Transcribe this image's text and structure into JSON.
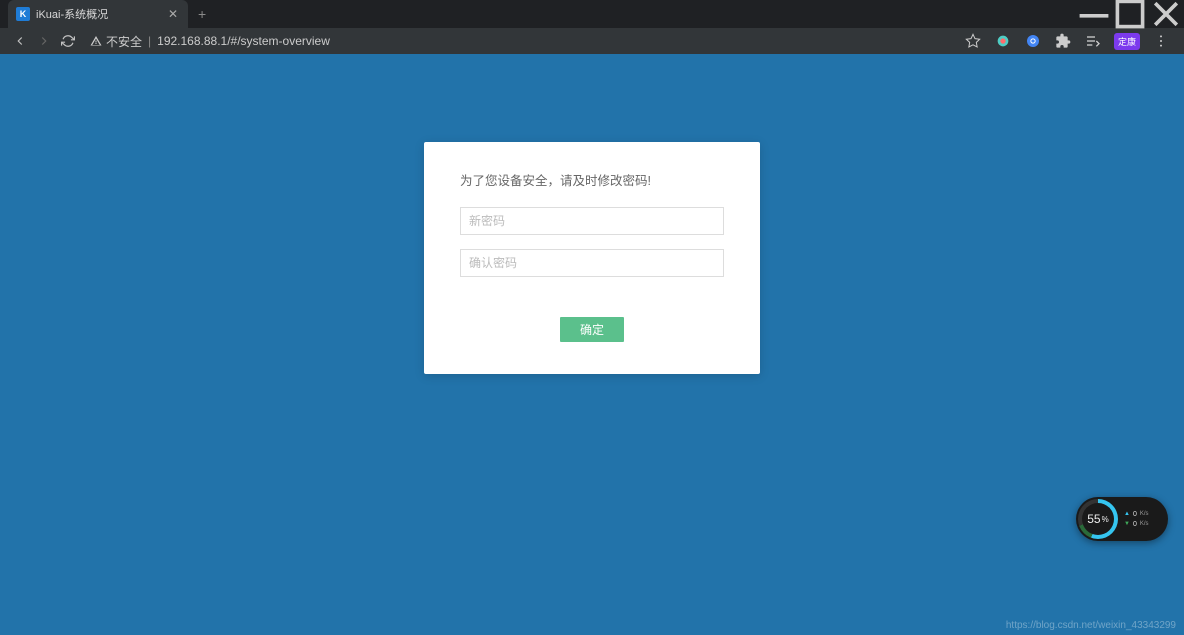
{
  "window": {
    "tab_title": "iKuai-系统概况",
    "favicon_letter": "K"
  },
  "address_bar": {
    "insecure_label": "不安全",
    "url": "192.168.88.1/#/system-overview"
  },
  "profile": {
    "avatar_label": "定康"
  },
  "dialog": {
    "message": "为了您设备安全，请及时修改密码!",
    "new_password_placeholder": "新密码",
    "confirm_password_placeholder": "确认密码",
    "ok_label": "确定"
  },
  "net_widget": {
    "percent": "55",
    "percent_suffix": "%",
    "up_value": "0",
    "up_unit": "K/s",
    "down_value": "0",
    "down_unit": "K/s"
  },
  "watermark": "https://blog.csdn.net/weixin_43343299"
}
